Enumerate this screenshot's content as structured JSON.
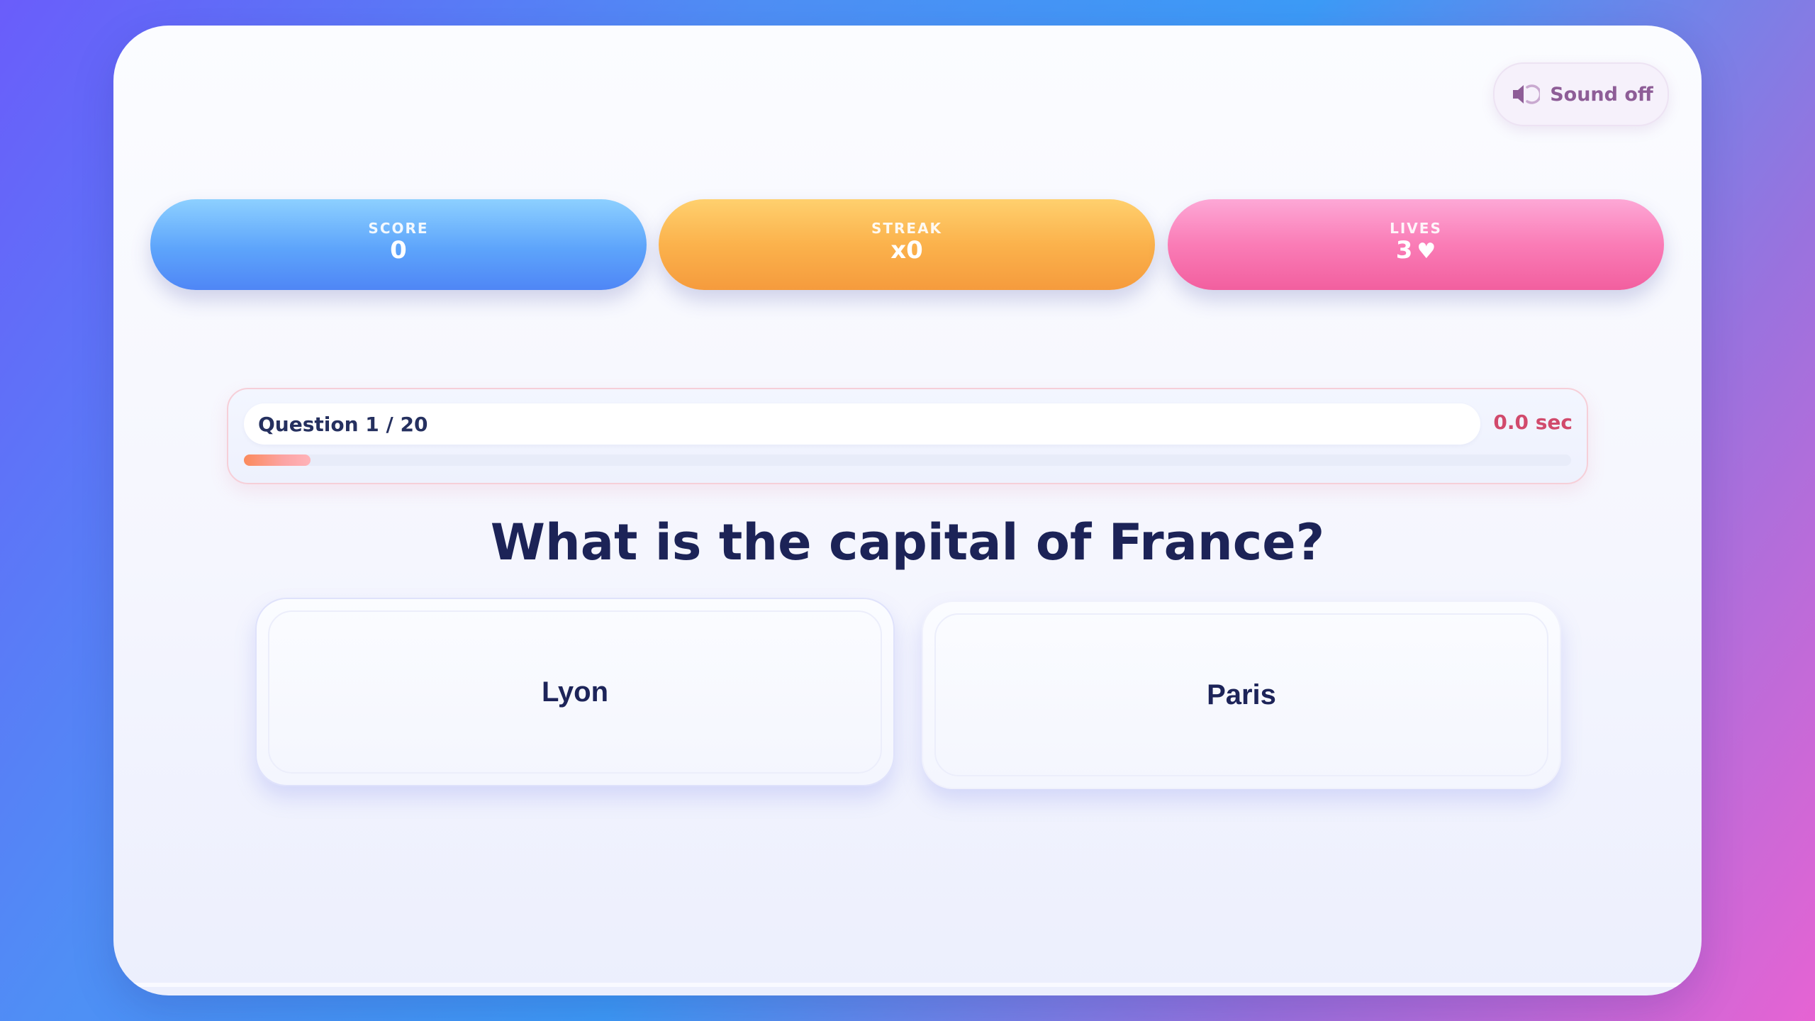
{
  "sound": {
    "label": "Sound off",
    "icon": "speaker-muted-icon"
  },
  "stats": {
    "score": {
      "label": "SCORE",
      "value": "0"
    },
    "streak": {
      "label": "STREAK",
      "value": "x0"
    },
    "lives": {
      "label": "LIVES",
      "value": "3",
      "icon": "heart-icon"
    }
  },
  "progress": {
    "counter": "Question 1 / 20",
    "timer": "0.0 sec",
    "fraction": 0.05
  },
  "question": {
    "text": "What is the capital of France?"
  },
  "answers": [
    {
      "label": "Lyon"
    },
    {
      "label": "Paris"
    }
  ],
  "colors": {
    "score": "#5da4fb",
    "streak": "#fbb24c",
    "lives": "#fa7cb6",
    "text_dark": "#1c2357",
    "timer": "#d14a6c"
  }
}
